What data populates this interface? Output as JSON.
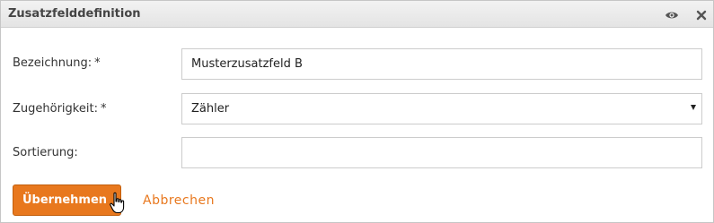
{
  "dialog": {
    "title": "Zusatzfelddefinition",
    "icons": {
      "visibility": "eye-icon",
      "close": "close-icon"
    }
  },
  "form": {
    "bezeichnung": {
      "label": "Bezeichnung:",
      "required_marker": "*",
      "value": "Musterzusatzfeld B"
    },
    "zugehoerigkeit": {
      "label": "Zugehörigkeit:",
      "required_marker": "*",
      "selected": "Zähler"
    },
    "sortierung": {
      "label": "Sortierung:",
      "value": ""
    }
  },
  "actions": {
    "submit_label": "Übernehmen",
    "cancel_label": "Abbrechen"
  },
  "colors": {
    "accent": "#e8781e",
    "header_bg": "#e9e9e9",
    "border": "#cccccc"
  }
}
